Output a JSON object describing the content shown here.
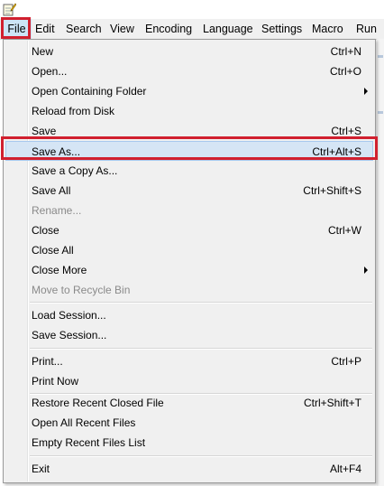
{
  "menubar": {
    "items": [
      "File",
      "Edit",
      "Search",
      "View",
      "Encoding",
      "Language",
      "Settings",
      "Macro",
      "Run"
    ]
  },
  "file_menu": {
    "new": {
      "label": "New",
      "shortcut": "Ctrl+N"
    },
    "open": {
      "label": "Open...",
      "shortcut": "Ctrl+O"
    },
    "open_containing_folder": {
      "label": "Open Containing Folder"
    },
    "reload_from_disk": {
      "label": "Reload from Disk"
    },
    "save": {
      "label": "Save",
      "shortcut": "Ctrl+S"
    },
    "save_as": {
      "label": "Save As...",
      "shortcut": "Ctrl+Alt+S"
    },
    "save_copy_as": {
      "label": "Save a Copy As..."
    },
    "save_all": {
      "label": "Save All",
      "shortcut": "Ctrl+Shift+S"
    },
    "rename": {
      "label": "Rename..."
    },
    "close": {
      "label": "Close",
      "shortcut": "Ctrl+W"
    },
    "close_all": {
      "label": "Close All"
    },
    "close_more": {
      "label": "Close More"
    },
    "move_to_recycle_bin": {
      "label": "Move to Recycle Bin"
    },
    "load_session": {
      "label": "Load Session..."
    },
    "save_session": {
      "label": "Save Session..."
    },
    "print": {
      "label": "Print...",
      "shortcut": "Ctrl+P"
    },
    "print_now": {
      "label": "Print Now"
    },
    "restore_recent_closed_file": {
      "label": "Restore Recent Closed File",
      "shortcut": "Ctrl+Shift+T"
    },
    "open_all_recent_files": {
      "label": "Open All Recent Files"
    },
    "empty_recent_files_list": {
      "label": "Empty Recent Files List"
    },
    "exit": {
      "label": "Exit",
      "shortcut": "Alt+F4"
    }
  },
  "icons": {
    "app": "notepad-app-icon",
    "submenu": "submenu-arrow-icon"
  },
  "colors": {
    "highlight_border": "#d1202f",
    "hover_background": "#d5e5f5",
    "menu_background": "#f0f0f0",
    "disabled_text": "#8a8a8a"
  }
}
